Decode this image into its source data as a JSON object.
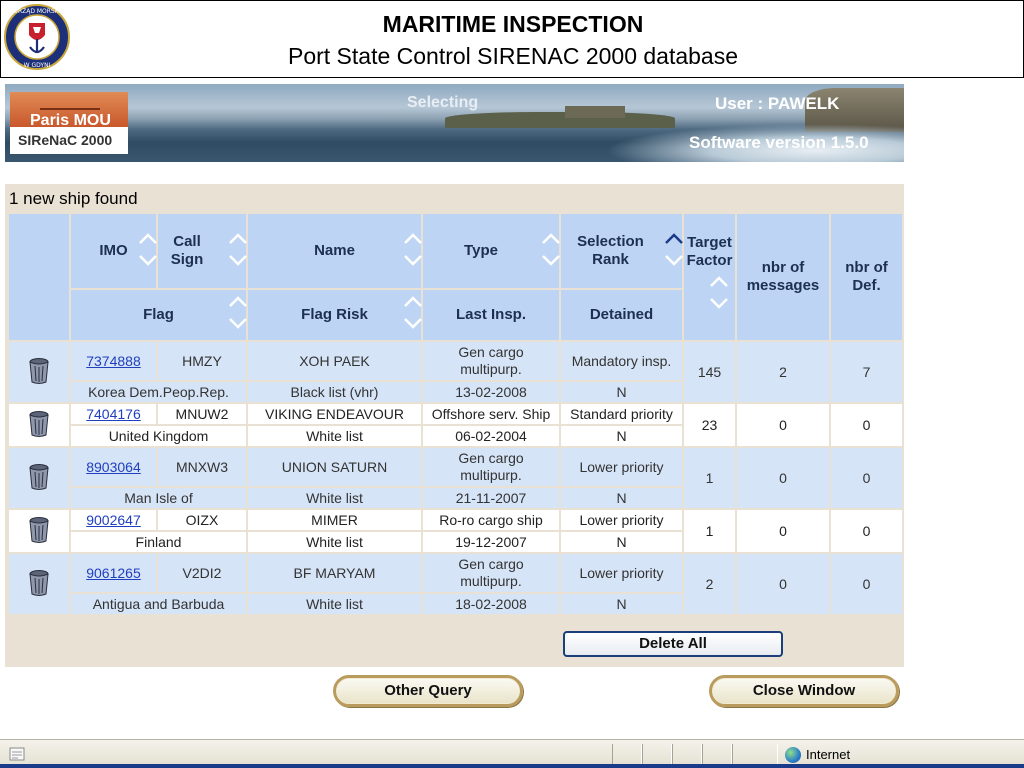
{
  "slide": {
    "title": "MARITIME INSPECTION",
    "subtitle": "Port State Control SIRENAC 2000 database",
    "seal_text": "URZĄD MORSKI W GDYNI"
  },
  "banner": {
    "logo_name": "Paris MOU",
    "logo_sub": "SIReNaC 2000",
    "mode": "Selecting",
    "user": "User : PAWELK",
    "version": "Software version 1.5.0"
  },
  "results": {
    "count_label": "1 new ship found",
    "headers": {
      "imo": "IMO",
      "call_sign": "Call Sign",
      "name": "Name",
      "type": "Type",
      "selection_rank": "Selection Rank",
      "target_factor": "Target Factor",
      "nbr_messages": "nbr of messages",
      "nbr_def": "nbr of Def.",
      "flag": "Flag",
      "flag_risk": "Flag Risk",
      "last_insp": "Last Insp.",
      "detained": "Detained"
    },
    "rows": [
      {
        "imo": "7374888",
        "call_sign": "HMZY",
        "name": "XOH PAEK",
        "type": "Gen cargo multipurp.",
        "selection_rank": "Mandatory insp.",
        "target_factor": "145",
        "nbr_messages": "2",
        "nbr_def": "7",
        "flag": "Korea Dem.Peop.Rep.",
        "flag_risk": "Black list (vhr)",
        "last_insp": "13-02-2008",
        "detained": "N"
      },
      {
        "imo": "7404176",
        "call_sign": "MNUW2",
        "name": "VIKING ENDEAVOUR",
        "type": "Offshore serv. Ship",
        "selection_rank": "Standard priority",
        "target_factor": "23",
        "nbr_messages": "0",
        "nbr_def": "0",
        "flag": "United Kingdom",
        "flag_risk": "White list",
        "last_insp": "06-02-2004",
        "detained": "N"
      },
      {
        "imo": "8903064",
        "call_sign": "MNXW3",
        "name": "UNION SATURN",
        "type": "Gen cargo multipurp.",
        "selection_rank": "Lower priority",
        "target_factor": "1",
        "nbr_messages": "0",
        "nbr_def": "0",
        "flag": "Man Isle of",
        "flag_risk": "White list",
        "last_insp": "21-11-2007",
        "detained": "N"
      },
      {
        "imo": "9002647",
        "call_sign": "OIZX",
        "name": "MIMER",
        "type": "Ro-ro cargo ship",
        "selection_rank": "Lower priority",
        "target_factor": "1",
        "nbr_messages": "0",
        "nbr_def": "0",
        "flag": "Finland",
        "flag_risk": "White list",
        "last_insp": "19-12-2007",
        "detained": "N"
      },
      {
        "imo": "9061265",
        "call_sign": "V2DI2",
        "name": "BF MARYAM",
        "type": "Gen cargo multipurp.",
        "selection_rank": "Lower priority",
        "target_factor": "2",
        "nbr_messages": "0",
        "nbr_def": "0",
        "flag": "Antigua and Barbuda",
        "flag_risk": "White list",
        "last_insp": "18-02-2008",
        "detained": "N"
      }
    ],
    "delete_all_label": "Delete All"
  },
  "buttons": {
    "other_query": "Other Query",
    "close_window": "Close Window"
  },
  "statusbar": {
    "zone": "Internet"
  },
  "colors": {
    "header_blue": "#bdd4f4",
    "row_blue": "#d6e4f7",
    "panel_beige": "#e9e1d4",
    "link_blue": "#1f3fbf"
  }
}
